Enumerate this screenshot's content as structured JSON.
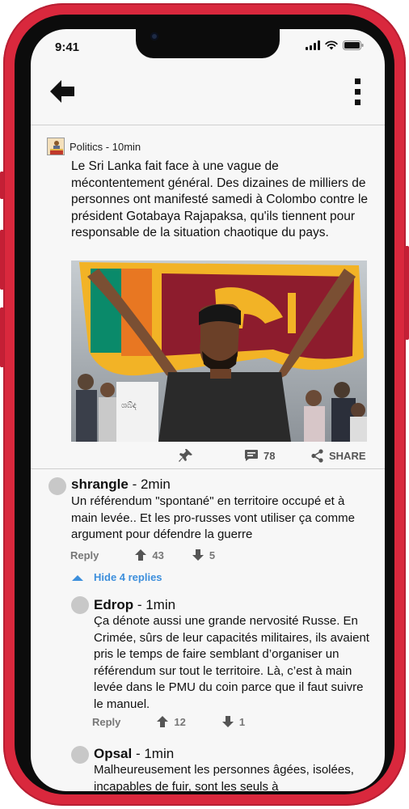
{
  "status_bar": {
    "time": "9:41"
  },
  "post": {
    "category": "Politics",
    "time_ago": "10min",
    "meta_text": "Politics - 10min",
    "body": "Le Sri Lanka fait face à une vague de mécontentement général. Des dizaines de milliers de personnes ont manifesté samedi à Colombo contre le président Gotabaya Rajapaksa, qu'ils tiennent pour responsable de la situation chaotique du pays.",
    "comment_count": "78",
    "share_label": "SHARE"
  },
  "comments": [
    {
      "author": "shrangle",
      "time": " - 2min",
      "body": "Un référendum \"spontané\" en territoire occupé et à main levée.. Et les pro-russes vont utiliser ça comme argument pour défendre la guerre",
      "reply_label": "Reply",
      "upvotes": "43",
      "downvotes": "5"
    }
  ],
  "hide_replies_label": "Hide 4 replies",
  "replies": [
    {
      "author": "Edrop",
      "time": " - 1min",
      "body": "Ça dénote aussi une grande nervosité Russe. En Crimée, sûrs de leur capacités militaires, ils avaient pris le temps de faire semblant d’organiser un référendum sur tout le territoire. Là, c’est à main levée dans le PMU du coin parce que il faut suivre le manuel.",
      "reply_label": "Reply",
      "upvotes": "12",
      "downvotes": "1"
    },
    {
      "author": "Opsal",
      "time": " - 1min",
      "body": "Malheureusement les personnes âgées, isolées, incapables de fuir, sont les seuls à"
    }
  ],
  "colors": {
    "phone_frame": "#d9283d",
    "screen_bg": "#f7f7f7",
    "link_blue": "#3d8fdc",
    "muted_text": "#777777"
  },
  "icons": [
    "back-arrow-icon",
    "kebab-menu-icon",
    "pin-icon",
    "comment-icon",
    "share-icon",
    "upvote-icon",
    "downvote-icon",
    "chevron-up-icon"
  ]
}
